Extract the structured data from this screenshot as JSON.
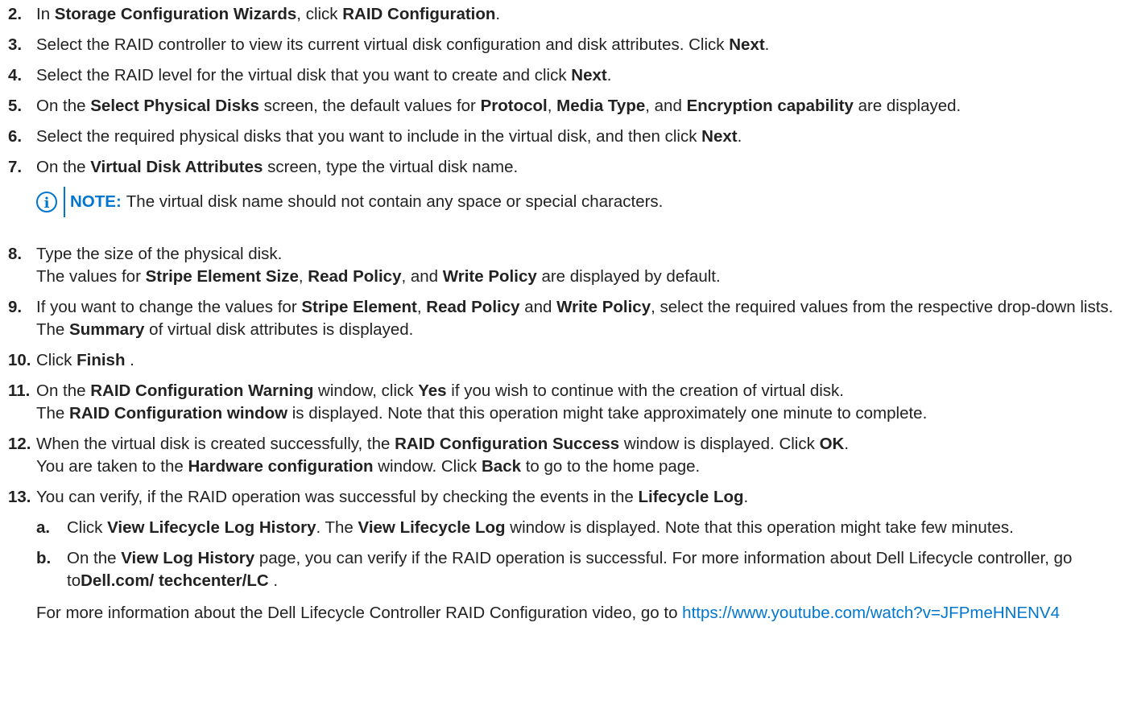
{
  "steps": [
    {
      "num": "2.",
      "t1": "In ",
      "b1": "Storage Configuration Wizards",
      "t2": ", click ",
      "b2": "RAID Configuration",
      "t3": "."
    },
    {
      "num": "3.",
      "t1": "Select the RAID controller to view its current virtual disk configuration and disk attributes. Click ",
      "b1": "Next",
      "t2": "."
    },
    {
      "num": "4.",
      "t1": "Select the RAID level for the virtual disk that you want to create and click ",
      "b1": "Next",
      "t2": "."
    },
    {
      "num": "5.",
      "t1": "On the ",
      "b1": "Select Physical Disks",
      "t2": " screen, the default values for ",
      "b2": "Protocol",
      "t3": ", ",
      "b3": "Media Type",
      "t4": ", and ",
      "b4": "Encryption capability",
      "t5": " are displayed."
    },
    {
      "num": "6.",
      "t1": "Select the required physical disks that you want to include in the virtual disk, and then click ",
      "b1": "Next",
      "t2": "."
    },
    {
      "num": "7.",
      "t1": "On the ",
      "b1": "Virtual Disk Attributes",
      "t2": " screen, type the virtual disk name."
    },
    {
      "num": "8.",
      "t1": "Type the size of the physical disk.",
      "l2a": "The values for ",
      "l2b1": "Stripe Element Size",
      "l2b": ", ",
      "l2b2": "Read Policy",
      "l2c": ", and ",
      "l2b3": "Write Policy",
      "l2d": " are displayed by default."
    },
    {
      "num": "9.",
      "t1": "If you want to change the values for ",
      "b1": "Stripe Element",
      "t2": ", ",
      "b2": "Read Policy",
      "t3": " and ",
      "b3": "Write Policy",
      "t4": ", select the required values from the respective drop-down lists.",
      "l2a": "The ",
      "l2b1": "Summary",
      "l2b": " of virtual disk attributes is displayed."
    },
    {
      "num": "10.",
      "t1": "Click ",
      "b1": "Finish",
      "t2": " ."
    },
    {
      "num": "11.",
      "t1": "On the ",
      "b1": "RAID Configuration Warning",
      "t2": " window, click ",
      "b2": "Yes",
      "t3": " if you wish to continue with the creation of virtual disk.",
      "l2a": "The ",
      "l2b1": "RAID Configuration window",
      "l2b": " is displayed. Note that this operation might take approximately one minute to complete."
    },
    {
      "num": "12.",
      "t1": "When the virtual disk is created successfully, the ",
      "b1": "RAID Configuration Success",
      "t2": " window is displayed. Click ",
      "b2": "OK",
      "t3": ".",
      "l2a": "You are taken to the ",
      "l2b1": "Hardware configuration",
      "l2b": " window. Click ",
      "l2b2": "Back",
      "l2c": " to go to the home page."
    },
    {
      "num": "13.",
      "t1": "You can verify, if the RAID operation was successful by checking the events in the ",
      "b1": "Lifecycle Log",
      "t2": "."
    }
  ],
  "note": {
    "label": "NOTE:",
    "text": "The virtual disk name should not contain any space or special characters."
  },
  "substeps": [
    {
      "num": "a.",
      "t1": "Click ",
      "b1": "View Lifecycle Log History",
      "t2": ". The ",
      "b2": "View Lifecycle Log",
      "t3": " window is displayed. Note that this operation might take few minutes."
    },
    {
      "num": "b.",
      "t1": "On the ",
      "b1": "View Log History",
      "t2": " page, you can verify if the RAID operation is successful. For more information about Dell Lifecycle controller, go to",
      "b2": "Dell.com/ techcenter/LC",
      "t3": " ."
    }
  ],
  "tail": {
    "text": "For more information about the Dell Lifecycle Controller RAID Configuration video, go to ",
    "link": "https://www.youtube.com/watch?v=JFPmeHNENV4"
  },
  "colors": {
    "accent": "#0076ce",
    "text": "#222222"
  }
}
